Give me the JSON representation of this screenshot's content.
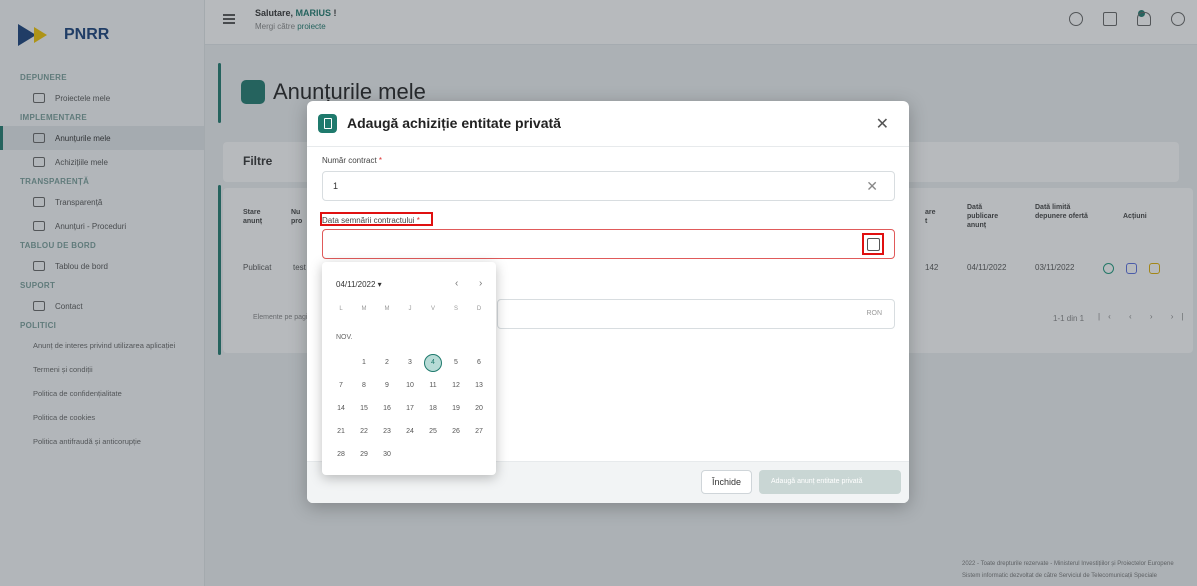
{
  "brand": {
    "logo_text": "PNRR"
  },
  "sidebar": {
    "sections": [
      {
        "title": "DEPUNERE",
        "items": [
          {
            "label": "Proiectele mele",
            "active": false
          }
        ]
      },
      {
        "title": "IMPLEMENTARE",
        "items": [
          {
            "label": "Anunțurile mele",
            "active": true
          },
          {
            "label": "Achizițiile mele",
            "active": false
          }
        ]
      },
      {
        "title": "TRANSPARENȚĂ",
        "items": [
          {
            "label": "Transparență",
            "active": false
          },
          {
            "label": "Anunțuri - Proceduri",
            "active": false
          }
        ]
      },
      {
        "title": "TABLOU DE BORD",
        "items": [
          {
            "label": "Tablou de bord",
            "active": false
          }
        ]
      },
      {
        "title": "SUPORT",
        "items": [
          {
            "label": "Contact",
            "active": false
          }
        ]
      },
      {
        "title": "POLITICI",
        "items": []
      }
    ],
    "policy_links": [
      "Anunț de interes privind utilizarea aplicației",
      "Termeni și condiții",
      "Politica de confidențialitate",
      "Politica de cookies",
      "Politica antifraudă și anticorupție"
    ]
  },
  "header": {
    "greeting": "Salutare, ",
    "user_name": "MARIUS",
    "greeting_suffix": " !",
    "subtext": "Mergi către ",
    "subtext_link": "proiecte"
  },
  "page": {
    "title": "Anunțurile mele",
    "filters_label": "Filtre",
    "table": {
      "headers": [
        "Stare anunț",
        "Nu pro",
        "are t",
        "Dată publicare anunț",
        "Dată limită depunere ofertă",
        "Acțiuni"
      ],
      "row": {
        "status": "Publicat",
        "name": "test",
        "id_fragment": "142",
        "published": "04/11/2022",
        "deadline": "03/11/2022"
      }
    },
    "per_page_label": "Elemente pe pagină",
    "pagination": "1-1 din 1",
    "footer_lines": [
      "2022 - Toate drepturile rezervate - Ministerul Investițiilor și Proiectelor Europene",
      "Sistem informatic dezvoltat de către Serviciul de Telecomunicații Speciale"
    ]
  },
  "modal": {
    "title": "Adaugă achiziție entitate privată",
    "contract_number_label": "Număr contract",
    "contract_number_value": "1",
    "signing_date_label": "Data semnării contractului",
    "signing_date_value": "",
    "currency": "RON",
    "close_button": "Închide",
    "submit_button": "Adaugă anunț entitate privată"
  },
  "datepicker": {
    "current_date": "04/11/2022",
    "weekdays": [
      "L",
      "M",
      "M",
      "J",
      "V",
      "S",
      "D"
    ],
    "month_label": "NOV.",
    "selected_day": 4,
    "days_in_month": 30
  }
}
